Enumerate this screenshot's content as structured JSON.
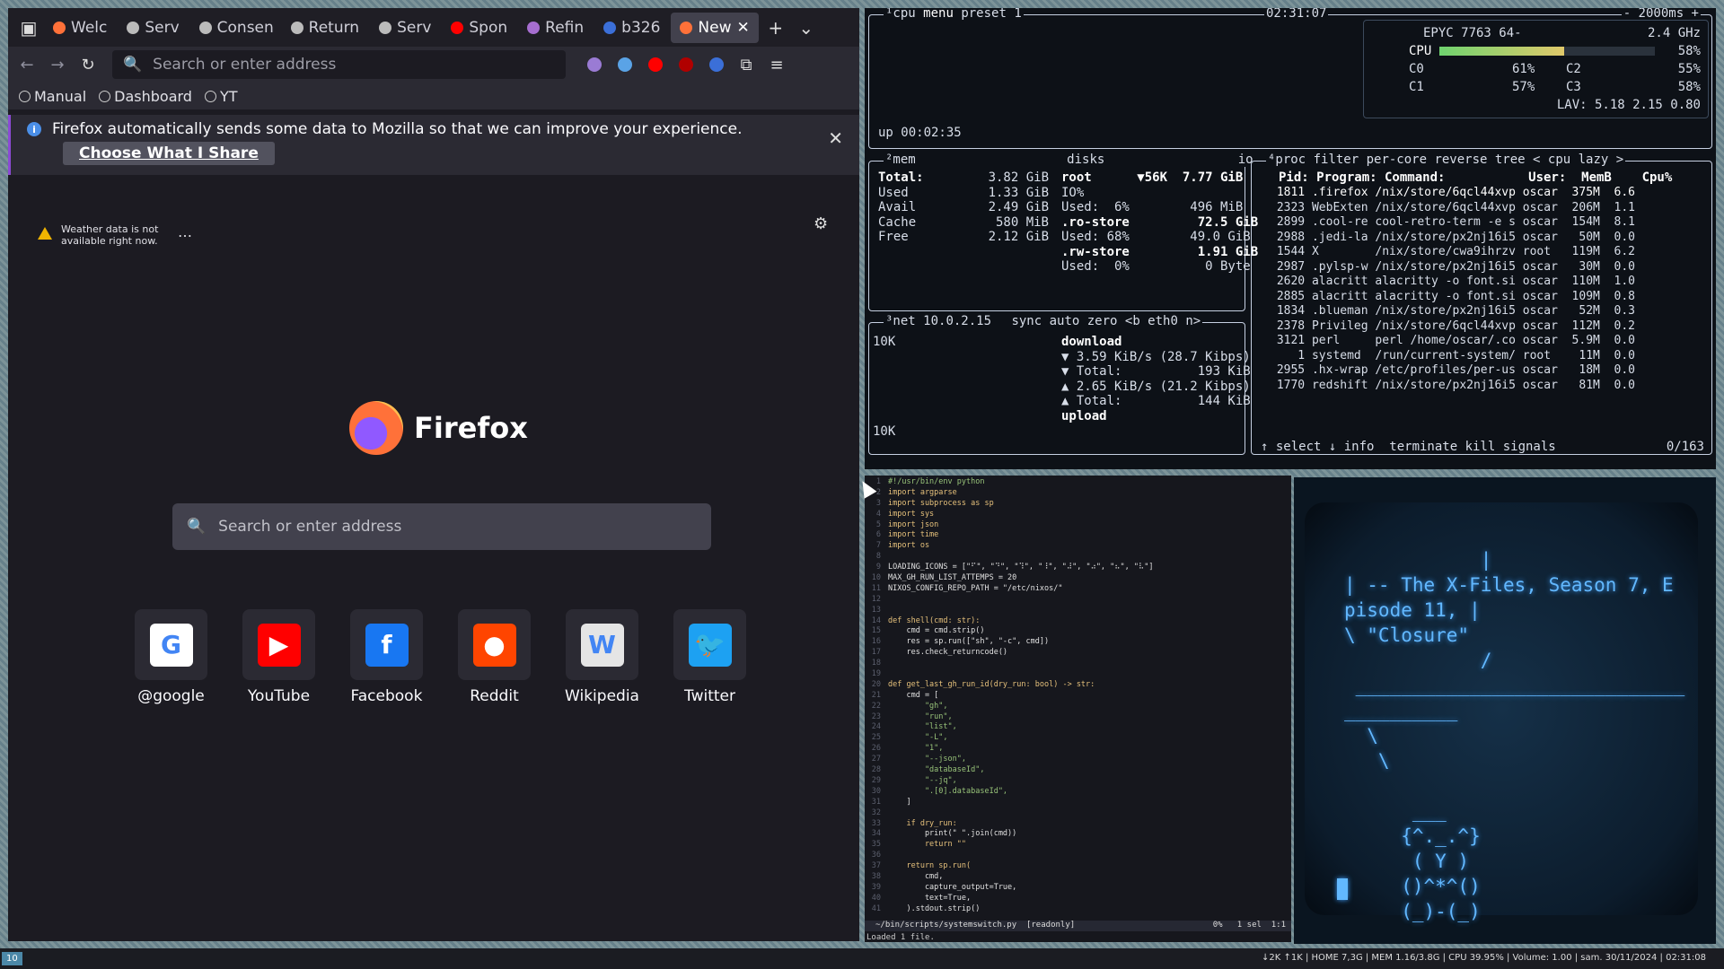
{
  "firefox": {
    "tabs": [
      "Welc",
      "Serv",
      "Consen",
      "Return",
      "Serv",
      "Spon",
      "Refin",
      "b326",
      "New"
    ],
    "address_placeholder": "Search or enter address",
    "bookmarks": [
      "Manual",
      "Dashboard",
      "YT"
    ],
    "notification": "Firefox automatically sends some data to Mozilla so that we can improve your experience.",
    "share_button": "Choose What I Share",
    "weather": "Weather data is not available right now.",
    "weather_menu": "…",
    "logo_text": "Firefox",
    "search_placeholder": "Search or enter address",
    "sites": [
      {
        "label": "@google",
        "letter": "G",
        "color": "#ffffff"
      },
      {
        "label": "YouTube",
        "letter": "▶",
        "color": "#ff0000"
      },
      {
        "label": "Facebook",
        "letter": "f",
        "color": "#1877f2"
      },
      {
        "label": "Reddit",
        "letter": "●",
        "color": "#ff4500"
      },
      {
        "label": "Wikipedia",
        "letter": "W",
        "color": "#e5e5e5"
      },
      {
        "label": "Twitter",
        "letter": "🐦",
        "color": "#1da1f2"
      }
    ]
  },
  "btop": {
    "cpu_title": "¹cpu",
    "menu": "menu",
    "preset": "preset 1",
    "clock": "02:31:07",
    "interval": "- 2000ms +",
    "cpu_model": "EPYC 7763 64-",
    "freq": "2.4 GHz",
    "cpu_label": "CPU",
    "cpu_pct": "58%",
    "cpu_fill": 0.58,
    "cores": [
      "C0",
      "61%",
      "C2",
      "55%",
      "C1",
      "57%",
      "C3",
      "58%"
    ],
    "lav": "LAV: 5.18 2.15 0.80",
    "uptime": "up 00:02:35",
    "mem_title": "²mem",
    "disks_title": "disks",
    "io": "io",
    "mem_rows": [
      [
        "Total:",
        "3.82 GiB"
      ],
      [
        "Used",
        "1.33 GiB"
      ],
      [
        "Avail",
        "2.49 GiB"
      ],
      [
        "Cache",
        "580 MiB"
      ],
      [
        "Free",
        "2.12 GiB"
      ]
    ],
    "disk_rows": [
      "root      ▼56K  7.77 GiB",
      "IO%",
      "Used:  6%        496 MiB",
      ".ro-store         72.5 GiB",
      "Used: 68%        49.0 GiB",
      ".rw-store         1.91 GiB",
      "Used:  0%          0 Byte"
    ],
    "net_title": "³net",
    "ip": "10.0.2.15",
    "net_opts": "sync auto zero <b eth0 n>",
    "net_scale": "10K",
    "net_rows": [
      "download",
      "▼ 3.59 KiB/s (28.7 Kibps)",
      "▼ Total:          193 KiB",
      "▲ 2.65 KiB/s (21.2 Kibps)",
      "▲ Total:          144 KiB",
      "upload"
    ],
    "proc_title": "⁴proc",
    "proc_opts": "filter   per-core reverse tree < cpu lazy >",
    "proc_header": "Pid: Program: Command:           User:  MemB    Cpu%",
    "procs": [
      " 1811 .firefox /nix/store/6qcl44xvp oscar  375M  6.6",
      " 2323 WebExten /nix/store/6qcl44xvp oscar  206M  1.1",
      " 2899 .cool-re cool-retro-term -e s oscar  154M  8.1",
      " 2988 .jedi-la /nix/store/px2nj16i5 oscar   50M  0.0",
      " 1544 X        /nix/store/cwa9ihrzv root   119M  6.2",
      " 2987 .pylsp-w /nix/store/px2nj16i5 oscar   30M  0.0",
      " 2620 alacritt alacritty -o font.si oscar  110M  1.0",
      " 2885 alacritt alacritty -o font.si oscar  109M  0.8",
      " 1834 .blueman /nix/store/px2nj16i5 oscar   52M  0.3",
      " 2378 Privileg /nix/store/6qcl44xvp oscar  112M  0.2",
      " 3121 perl     perl /home/oscar/.co oscar  5.9M  0.0",
      "    1 systemd  /run/current-system/ root    11M  0.0",
      " 2955 .hx-wrap /etc/profiles/per-us oscar   18M  0.0",
      " 1770 redshift /nix/store/px2nj16i5 oscar   81M  0.0"
    ],
    "proc_footer": "↑ select ↓ info  terminate kill signals",
    "proc_count": "0/163"
  },
  "editor": {
    "lines": [
      "#!/usr/bin/env python",
      "import argparse",
      "import subprocess as sp",
      "import sys",
      "import json",
      "import time",
      "import os",
      "",
      "LOADING_ICONS = [\"⠋\", \"⠙\", \"⠹\", \"⠸\", \"⠼\", \"⠴\", \"⠦\", \"⠧\"]",
      "MAX_GH_RUN_LIST_ATTEMPS = 20",
      "NIXOS_CONFIG_REPO_PATH = \"/etc/nixos/\"",
      "",
      "",
      "def shell(cmd: str):",
      "    cmd = cmd.strip()",
      "    res = sp.run([\"sh\", \"-c\", cmd])",
      "    res.check_returncode()",
      "",
      "",
      "def get_last_gh_run_id(dry_run: bool) -> str:",
      "    cmd = [",
      "        \"gh\",",
      "        \"run\",",
      "        \"list\",",
      "        \"-L\",",
      "        \"1\",",
      "        \"--json\",",
      "        \"databaseId\",",
      "        \"--jq\",",
      "        \".[0].databaseId\",",
      "    ]",
      "",
      "    if dry_run:",
      "        print(\" \".join(cmd))",
      "        return \"\"",
      "",
      "    return sp.run(",
      "        cmd,",
      "        capture_output=True,",
      "        text=True,",
      "    ).stdout.strip()"
    ],
    "status_left": "~/bin/scripts/systemswitch.py  [readonly]",
    "status_right": "0%   1 sel  1:1",
    "loaded": "Loaded 1 file."
  },
  "retro": {
    "text": "            |\n| -- The X-Files, Season 7, E\npisode 11, |\n\\ \"Closure\"\n            /\n _____________________________\n__________\n  \\\n   \\\n\n      ___\n     {^._.^}\n      ( Y )\n     ()^*^()\n     (_)-(_)"
  },
  "bar": {
    "workspace": "10",
    "status": "↓2K ↑1K | HOME 7,3G | MEM 1.16/3.8G | CPU 39.95% | Volume: 1.00 | sam. 30/11/2024 | 02:31:08"
  }
}
